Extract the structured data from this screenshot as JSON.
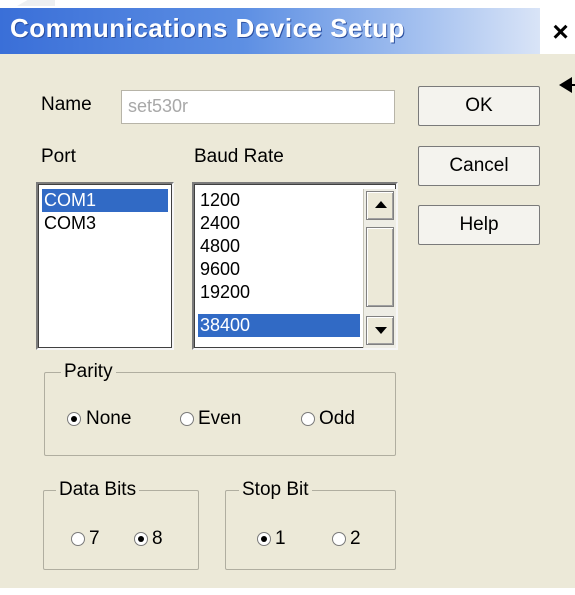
{
  "dialog": {
    "title": "Communications Device Setup",
    "close_glyph": "×"
  },
  "name_field": {
    "label": "Name",
    "value": "set530r"
  },
  "buttons": {
    "ok": "OK",
    "cancel": "Cancel",
    "help": "Help"
  },
  "port": {
    "label": "Port",
    "items": [
      "COM1",
      "COM3"
    ],
    "selected": "COM1"
  },
  "baud_rate": {
    "label": "Baud Rate",
    "items": [
      "1200",
      "2400",
      "4800",
      "9600",
      "19200",
      "38400"
    ],
    "selected": "38400"
  },
  "parity": {
    "label": "Parity",
    "options": [
      "None",
      "Even",
      "Odd"
    ],
    "selected": "None"
  },
  "data_bits": {
    "label": "Data Bits",
    "options": [
      "7",
      "8"
    ],
    "selected": "8"
  },
  "stop_bit": {
    "label": "Stop Bit",
    "options": [
      "1",
      "2"
    ],
    "selected": "1"
  }
}
